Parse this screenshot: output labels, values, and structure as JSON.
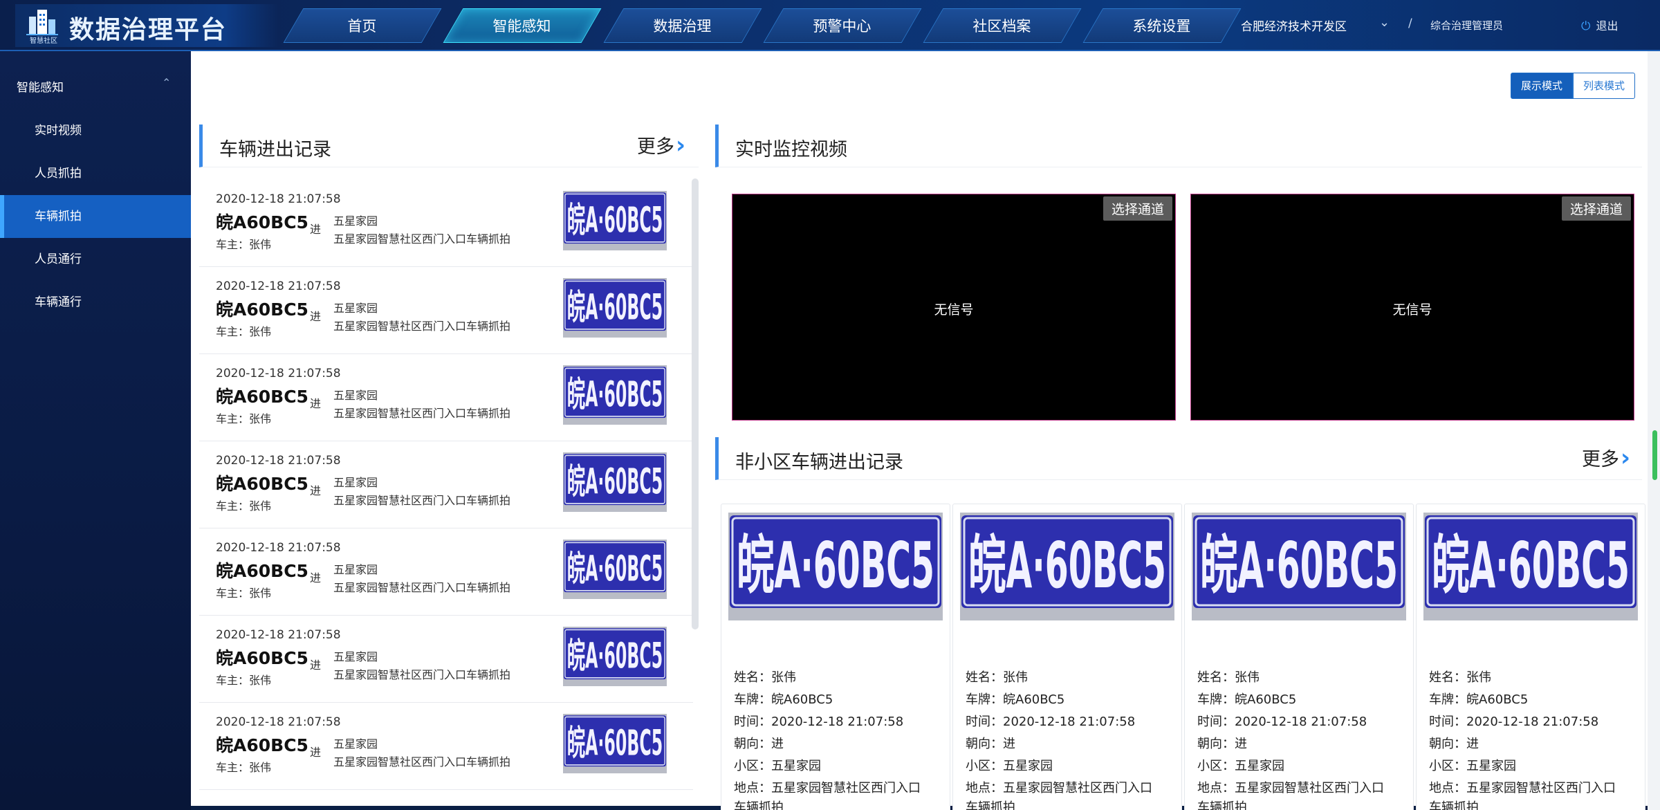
{
  "header": {
    "logo_sub": "智慧社区",
    "title": "数据治理平台",
    "nav": [
      "首页",
      "智能感知",
      "数据治理",
      "预警中心",
      "社区档案",
      "系统设置"
    ],
    "active_nav": 1,
    "region": "合肥经济技术开发区",
    "slash": "/",
    "role": "综合治理管理员",
    "logout": "退出"
  },
  "sidebar": {
    "group": "智能感知",
    "items": [
      "实时视频",
      "人员抓拍",
      "车辆抓拍",
      "人员通行",
      "车辆通行"
    ],
    "active_item": 2
  },
  "mode_switch": {
    "display": "展示模式",
    "list": "列表模式"
  },
  "vehicle_records": {
    "title": "车辆进出记录",
    "more": "更多",
    "items": [
      {
        "time": "2020-12-18 21:07:58",
        "plate": "皖A60BC5",
        "owner": "车主：张伟",
        "dir": "进",
        "community": "五星家园",
        "location": "五星家园智慧社区西门入口车辆抓拍"
      },
      {
        "time": "2020-12-18 21:07:58",
        "plate": "皖A60BC5",
        "owner": "车主：张伟",
        "dir": "进",
        "community": "五星家园",
        "location": "五星家园智慧社区西门入口车辆抓拍"
      },
      {
        "time": "2020-12-18 21:07:58",
        "plate": "皖A60BC5",
        "owner": "车主：张伟",
        "dir": "进",
        "community": "五星家园",
        "location": "五星家园智慧社区西门入口车辆抓拍"
      },
      {
        "time": "2020-12-18 21:07:58",
        "plate": "皖A60BC5",
        "owner": "车主：张伟",
        "dir": "进",
        "community": "五星家园",
        "location": "五星家园智慧社区西门入口车辆抓拍"
      },
      {
        "time": "2020-12-18 21:07:58",
        "plate": "皖A60BC5",
        "owner": "车主：张伟",
        "dir": "进",
        "community": "五星家园",
        "location": "五星家园智慧社区西门入口车辆抓拍"
      },
      {
        "time": "2020-12-18 21:07:58",
        "plate": "皖A60BC5",
        "owner": "车主：张伟",
        "dir": "进",
        "community": "五星家园",
        "location": "五星家园智慧社区西门入口车辆抓拍"
      },
      {
        "time": "2020-12-18 21:07:58",
        "plate": "皖A60BC5",
        "owner": "车主：张伟",
        "dir": "进",
        "community": "五星家园",
        "location": "五星家园智慧社区西门入口车辆抓拍"
      }
    ]
  },
  "plate_image_text": "皖A·60BC5",
  "monitor": {
    "title": "实时监控视频",
    "videos": [
      {
        "channel_btn": "选择通道",
        "status": "无信号"
      },
      {
        "channel_btn": "选择通道",
        "status": "无信号"
      }
    ]
  },
  "non_resident": {
    "title": "非小区车辆进出记录",
    "more": "更多",
    "cards": [
      {
        "name": "姓名：张伟",
        "plate": "车牌：皖A60BC5",
        "time": "时间：2020-12-18 21:07:58",
        "dir": "朝向：进",
        "community": "小区：五星家园",
        "location": "地点：五星家园智慧社区西门入口",
        "location2": "车辆抓拍"
      },
      {
        "name": "姓名：张伟",
        "plate": "车牌：皖A60BC5",
        "time": "时间：2020-12-18 21:07:58",
        "dir": "朝向：进",
        "community": "小区：五星家园",
        "location": "地点：五星家园智慧社区西门入口",
        "location2": "车辆抓拍"
      },
      {
        "name": "姓名：张伟",
        "plate": "车牌：皖A60BC5",
        "time": "时间：2020-12-18 21:07:58",
        "dir": "朝向：进",
        "community": "小区：五星家园",
        "location": "地点：五星家园智慧社区西门入口",
        "location2": "车辆抓拍"
      },
      {
        "name": "姓名：张伟",
        "plate": "车牌：皖A60BC5",
        "time": "时间：2020-12-18 21:07:58",
        "dir": "朝向：进",
        "community": "小区：五星家园",
        "location": "地点：五星家园智慧社区西门入口",
        "location2": "车辆抓拍"
      }
    ]
  },
  "icons": {
    "logo": "building-logo-icon",
    "caret": "chevron-down-icon",
    "power": "power-icon",
    "more": "chevron-right-icon"
  },
  "colors": {
    "header_bg": "#0c2c66",
    "active_tab": "#1b86b8",
    "sidebar_active": "#1560c2",
    "accent": "#3a8ae8",
    "plate_blue": "#2d2fae"
  }
}
